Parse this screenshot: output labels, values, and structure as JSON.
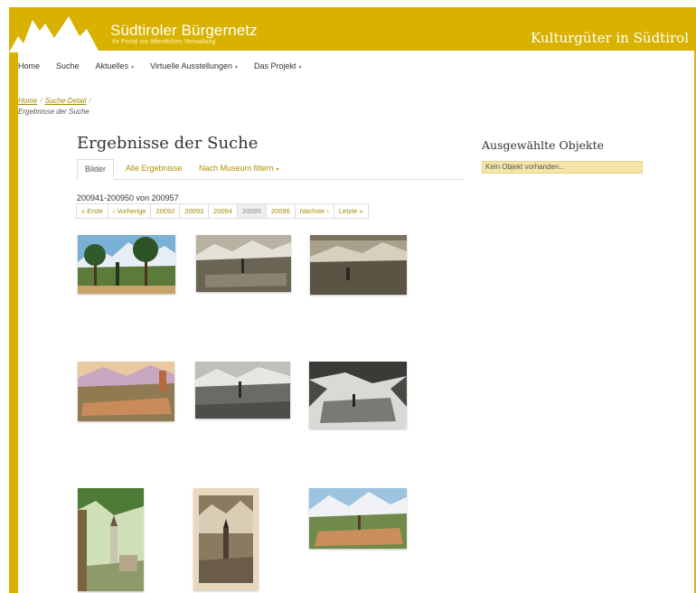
{
  "header": {
    "brand_title": "Südtiroler Bürgernetz",
    "brand_subtitle": "Ihr Portal zur öffentlichen Verwaltung",
    "right_title": "Kulturgüter in Südtirol",
    "accent": "#d9b100"
  },
  "nav": {
    "items": [
      {
        "label": "Home",
        "dropdown": false
      },
      {
        "label": "Suche",
        "dropdown": false
      },
      {
        "label": "Aktuelles",
        "dropdown": true
      },
      {
        "label": "Virtuelle Ausstellungen",
        "dropdown": true
      },
      {
        "label": "Das Projekt",
        "dropdown": true
      }
    ],
    "caret": "▾"
  },
  "breadcrumb": {
    "items": [
      "Home",
      "Suche-Detail"
    ],
    "separator": "/",
    "current": "Ergebnisse der Suche"
  },
  "results": {
    "title": "Ergebnisse der Suche",
    "tabs": [
      {
        "label": "Bilder",
        "active": true
      },
      {
        "label": "Alle Ergebnisse",
        "active": false
      },
      {
        "label": "Nach Museum filtern",
        "active": false,
        "dropdown": true
      }
    ],
    "range_text": "200941-200950 von 200957",
    "pager": [
      {
        "label": "« Erste"
      },
      {
        "label": "‹ Vorherige"
      },
      {
        "label": "20092"
      },
      {
        "label": "20093"
      },
      {
        "label": "20094"
      },
      {
        "label": "20095",
        "active": true
      },
      {
        "label": "20096"
      },
      {
        "label": "Nächste ›"
      },
      {
        "label": "Letzte »"
      }
    ]
  },
  "sidebar": {
    "title": "Ausgewählte Objekte",
    "empty_text": "Kein Objekt vorhanden..."
  },
  "thumbnails": [
    {
      "name": "palms-mountain-postcard",
      "style": "color-palms"
    },
    {
      "name": "town-valley-sepia-1",
      "style": "sepia"
    },
    {
      "name": "town-valley-sepia-2",
      "style": "sepia-dark"
    },
    {
      "name": "color-town-mountain",
      "style": "color-town"
    },
    {
      "name": "gray-valley-town",
      "style": "gray"
    },
    {
      "name": "framed-town-branches",
      "style": "gray-framed"
    },
    {
      "name": "pergola-church-postcard",
      "style": "color-pergola"
    },
    {
      "name": "sepia-church-tower",
      "style": "sepia-tall"
    },
    {
      "name": "color-town-alps",
      "style": "color-alps"
    }
  ]
}
